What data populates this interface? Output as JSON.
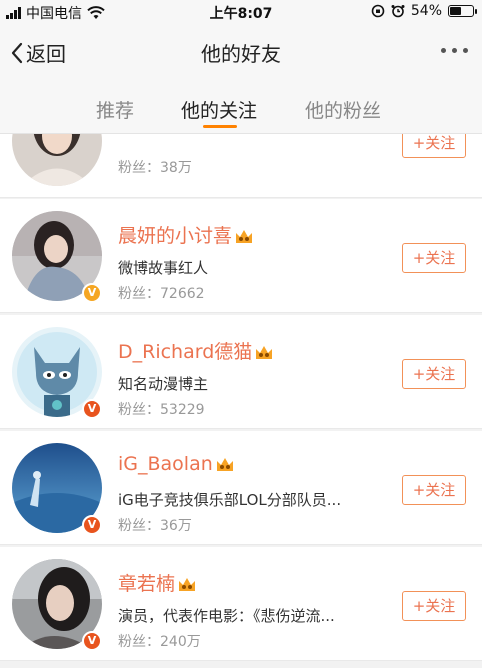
{
  "status": {
    "carrier": "中国电信",
    "time": "上午8:07",
    "battery": "54%",
    "battery_level": 0.54
  },
  "nav": {
    "back_label": "返回",
    "title": "他的好友"
  },
  "tabs": [
    {
      "label": "推荐",
      "active": false
    },
    {
      "label": "他的关注",
      "active": true
    },
    {
      "label": "他的粉丝",
      "active": false
    }
  ],
  "users": [
    {
      "name": "",
      "desc": "",
      "fans": "粉丝：38万",
      "follow_label": "+关注",
      "badge": ""
    },
    {
      "name": "晨妍的小讨喜",
      "desc": "微博故事红人",
      "fans": "粉丝：72662",
      "follow_label": "+关注",
      "badge": "V"
    },
    {
      "name": "D_Richard德猫",
      "desc": "知名动漫博主",
      "fans": "粉丝：53229",
      "follow_label": "+关注",
      "badge": "V"
    },
    {
      "name": "iG_Baolan",
      "desc": "iG电子竞技俱乐部LOL分部队员...",
      "fans": "粉丝：36万",
      "follow_label": "+关注",
      "badge": "V"
    },
    {
      "name": "章若楠",
      "desc": "演员，代表作电影：《悲伤逆流...",
      "fans": "粉丝：240万",
      "follow_label": "+关注",
      "badge": "V"
    }
  ],
  "colors": {
    "accent": "#ff8200",
    "name": "#eb7350",
    "badge_gold": "#f5a623",
    "badge_red": "#e8541e"
  }
}
